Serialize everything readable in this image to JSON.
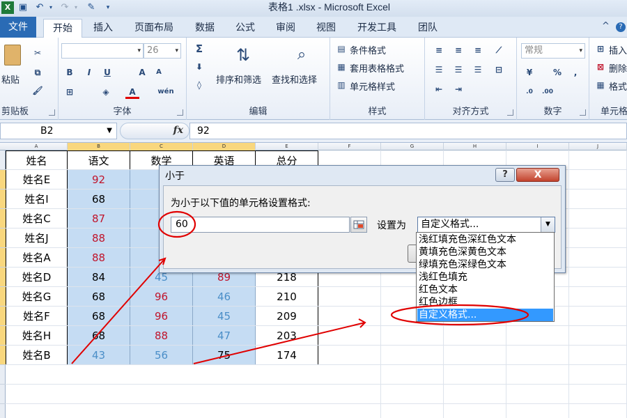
{
  "window": {
    "title": "表格1 .xlsx - Microsoft Excel"
  },
  "tabs": [
    "文件",
    "开始",
    "插入",
    "页面布局",
    "数据",
    "公式",
    "审阅",
    "视图",
    "开发工具",
    "团队"
  ],
  "ribbon": {
    "groups": [
      "剪贴板",
      "字体",
      "编辑",
      "样式",
      "对齐方式",
      "数字",
      "单元格"
    ],
    "paste_label": "粘贴",
    "font_size": "26",
    "sort_filter_label": "排序和筛选",
    "find_select_label": "查找和选择",
    "conditional_format_label": "条件格式",
    "table_format_label": "套用表格格式",
    "cell_style_label": "单元格样式",
    "number_format": "常规",
    "insert_label": "插入",
    "delete_label": "删除",
    "format_label": "格式",
    "percent_symbol": "%",
    "comma_symbol": ",",
    "sigma_symbol": "Σ",
    "bold": "B",
    "italic": "I",
    "underline": "U",
    "grow_font": "A",
    "shrink_font": "A",
    "font_color": "A",
    "wen_label": "wén",
    "fx_label": "fx"
  },
  "formula_bar": {
    "name_box": "B2",
    "formula": "92"
  },
  "sheet": {
    "column_letters": [
      "A",
      "B",
      "C",
      "D",
      "E",
      "F",
      "G",
      "H",
      "I",
      "J"
    ],
    "headers": [
      "姓名",
      "语文",
      "数学",
      "英语",
      "总分"
    ],
    "rows": [
      {
        "name": "姓名E",
        "yuwen": "92",
        "shuxue": "",
        "yingyu": "",
        "total": ""
      },
      {
        "name": "姓名I",
        "yuwen": "68",
        "shuxue": "",
        "yingyu": "",
        "total": ""
      },
      {
        "name": "姓名C",
        "yuwen": "87",
        "shuxue": "",
        "yingyu": "",
        "total": ""
      },
      {
        "name": "姓名J",
        "yuwen": "88",
        "shuxue": "",
        "yingyu": "",
        "total": ""
      },
      {
        "name": "姓名A",
        "yuwen": "88",
        "shuxue": "",
        "yingyu": "",
        "total": ""
      },
      {
        "name": "姓名D",
        "yuwen": "84",
        "shuxue": "45",
        "yingyu": "89",
        "total": "218"
      },
      {
        "name": "姓名G",
        "yuwen": "68",
        "shuxue": "96",
        "yingyu": "46",
        "total": "210"
      },
      {
        "name": "姓名F",
        "yuwen": "68",
        "shuxue": "96",
        "yingyu": "45",
        "total": "209"
      },
      {
        "name": "姓名H",
        "yuwen": "68",
        "shuxue": "88",
        "yingyu": "47",
        "total": "203"
      },
      {
        "name": "姓名B",
        "yuwen": "43",
        "shuxue": "56",
        "yingyu": "75",
        "total": "174"
      }
    ]
  },
  "dialog": {
    "title": "小于",
    "help": "?",
    "close": "X",
    "prompt": "为小于以下值的单元格设置格式:",
    "value": "60",
    "set_label": "设置为",
    "selected_format": "自定义格式...",
    "options": [
      "浅红填充色深红色文本",
      "黄填充色深黄色文本",
      "绿填充色深绿色文本",
      "浅红色填充",
      "红色文本",
      "红色边框",
      "自定义格式..."
    ]
  },
  "colors": {
    "file_tab": "#2a6bb5",
    "selection": "#c5dcf3",
    "header_highlight": "#f9d77e",
    "annotation_red": "#e00000",
    "list_highlight": "#3399ff",
    "value_red": "#c0142b",
    "value_blue": "#4a8ec8"
  }
}
